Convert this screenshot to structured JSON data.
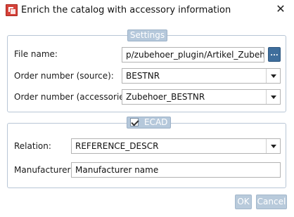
{
  "window": {
    "title": "Enrich the catalog with accessory information",
    "close_glyph": "✕"
  },
  "settings": {
    "legend": "Settings",
    "file_name": {
      "label": "File name:",
      "value": "p/zubehoer_plugin/Artikel_Zubehör_S",
      "browse_label": "..."
    },
    "order_source": {
      "label": "Order number (source):",
      "value": "BESTNR"
    },
    "order_accessories": {
      "label": "Order number (accessories):",
      "value": "Zubehoer_BESTNR"
    }
  },
  "ecad": {
    "legend": "ECAD",
    "checked": true,
    "relation": {
      "label": "Relation:",
      "value": "REFERENCE_DESCR"
    },
    "manufacturer": {
      "label": "Manufacturer:",
      "value": "Manufacturer name"
    }
  },
  "buttons": {
    "ok": "OK",
    "cancel": "Cancel"
  },
  "colors": {
    "accent": "#b5c8db",
    "group_border": "#b8c6d6",
    "browse": "#3f6e9c",
    "app_icon": "#d6423a"
  }
}
